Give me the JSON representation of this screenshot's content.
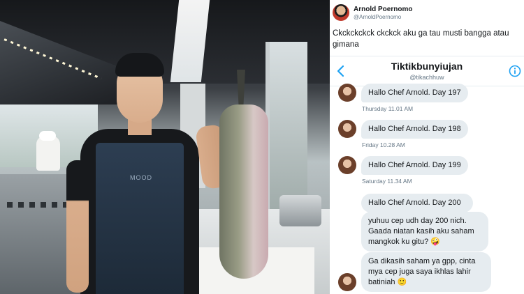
{
  "tweet": {
    "name": "Arnold Poernomo",
    "handle": "@ArnoldPoernomo",
    "text": "Ckckckckck ckckck aku ga tau musti bangga atau gimana"
  },
  "photo": {
    "apron_logo": "MOOD"
  },
  "dm": {
    "title": "Tiktikbunyiujan",
    "handle": "@tikachhuw",
    "back_icon": "chevron-left-icon",
    "info_icon": "info-icon",
    "accent_color": "#1da1f2",
    "messages": [
      {
        "text": "Hallo Chef Arnold. Day 197",
        "time": "Thursday 11.01 AM"
      },
      {
        "text": "Hallo Chef Arnold. Day 198",
        "time": "Friday 10.28 AM"
      },
      {
        "text": "Hallo Chef Arnold. Day 199",
        "time": "Saturday 11.34 AM"
      },
      {
        "text": "Hallo Chef Arnold. Day 200"
      },
      {
        "text": "yuhuu cep udh day 200 nich. Gaada niatan kasih aku saham mangkok ku gitu? 🤪"
      },
      {
        "text": "Ga dikasih saham ya gpp, cinta mya cep juga saya ikhlas lahir batiniah 🙂"
      }
    ]
  }
}
